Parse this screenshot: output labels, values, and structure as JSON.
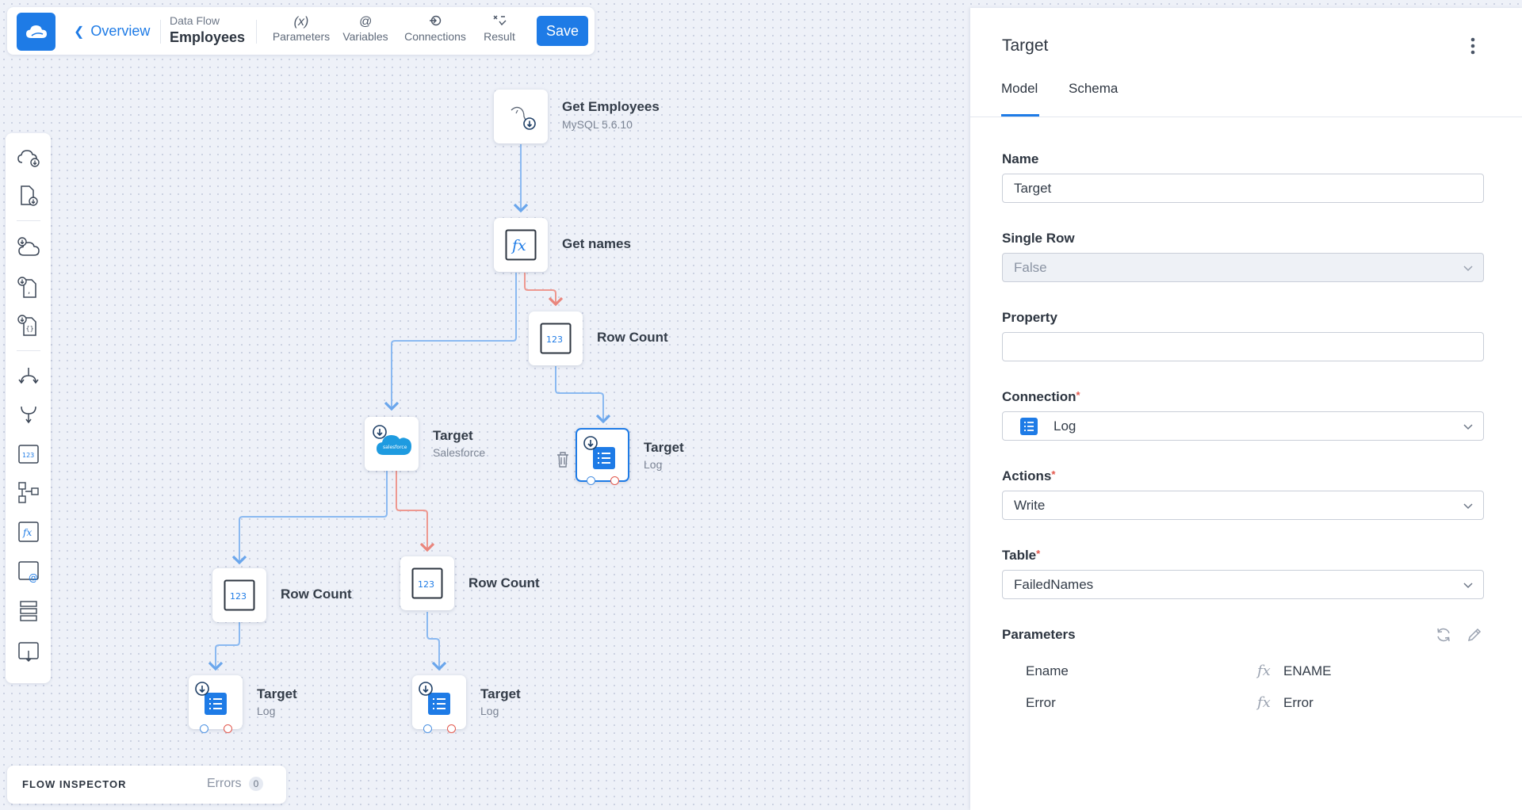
{
  "topbar": {
    "back_label": "Overview",
    "breadcrumb_type": "Data Flow",
    "breadcrumb_name": "Employees",
    "tools": [
      {
        "icon": "(x)",
        "label": "Parameters"
      },
      {
        "icon": "@",
        "label": "Variables"
      },
      {
        "icon": "connections-icon",
        "label": "Connections"
      },
      {
        "icon": "result-icon",
        "label": "Result"
      }
    ],
    "save_label": "Save"
  },
  "nodes": {
    "get_employees": {
      "title": "Get Employees",
      "subtitle": "MySQL 5.6.10"
    },
    "get_names": {
      "title": "Get names"
    },
    "row_count_1": {
      "title": "Row Count"
    },
    "target_salesforce": {
      "title": "Target",
      "subtitle": "Salesforce"
    },
    "target_log_selected": {
      "title": "Target",
      "subtitle": "Log"
    },
    "row_count_2": {
      "title": "Row Count"
    },
    "row_count_3": {
      "title": "Row Count"
    },
    "target_log_2": {
      "title": "Target",
      "subtitle": "Log"
    },
    "target_log_3": {
      "title": "Target",
      "subtitle": "Log"
    }
  },
  "inspector": {
    "title": "FLOW INSPECTOR",
    "errors_label": "Errors",
    "errors_count": "0"
  },
  "panel": {
    "title": "Target",
    "tabs": [
      {
        "label": "Model",
        "active": true
      },
      {
        "label": "Schema",
        "active": false
      }
    ],
    "name_label": "Name",
    "name_value": "Target",
    "single_row_label": "Single Row",
    "single_row_value": "False",
    "property_label": "Property",
    "property_value": "",
    "connection_label": "Connection",
    "connection_value": "Log",
    "actions_label": "Actions",
    "actions_value": "Write",
    "table_label": "Table",
    "table_value": "FailedNames",
    "parameters_label": "Parameters",
    "parameters": [
      {
        "name": "Ename",
        "value": "ENAME"
      },
      {
        "name": "Error",
        "value": "Error"
      }
    ]
  },
  "colors": {
    "accent": "#1e7be6",
    "error_link": "#e2574c",
    "success_link": "#4a90e2"
  }
}
